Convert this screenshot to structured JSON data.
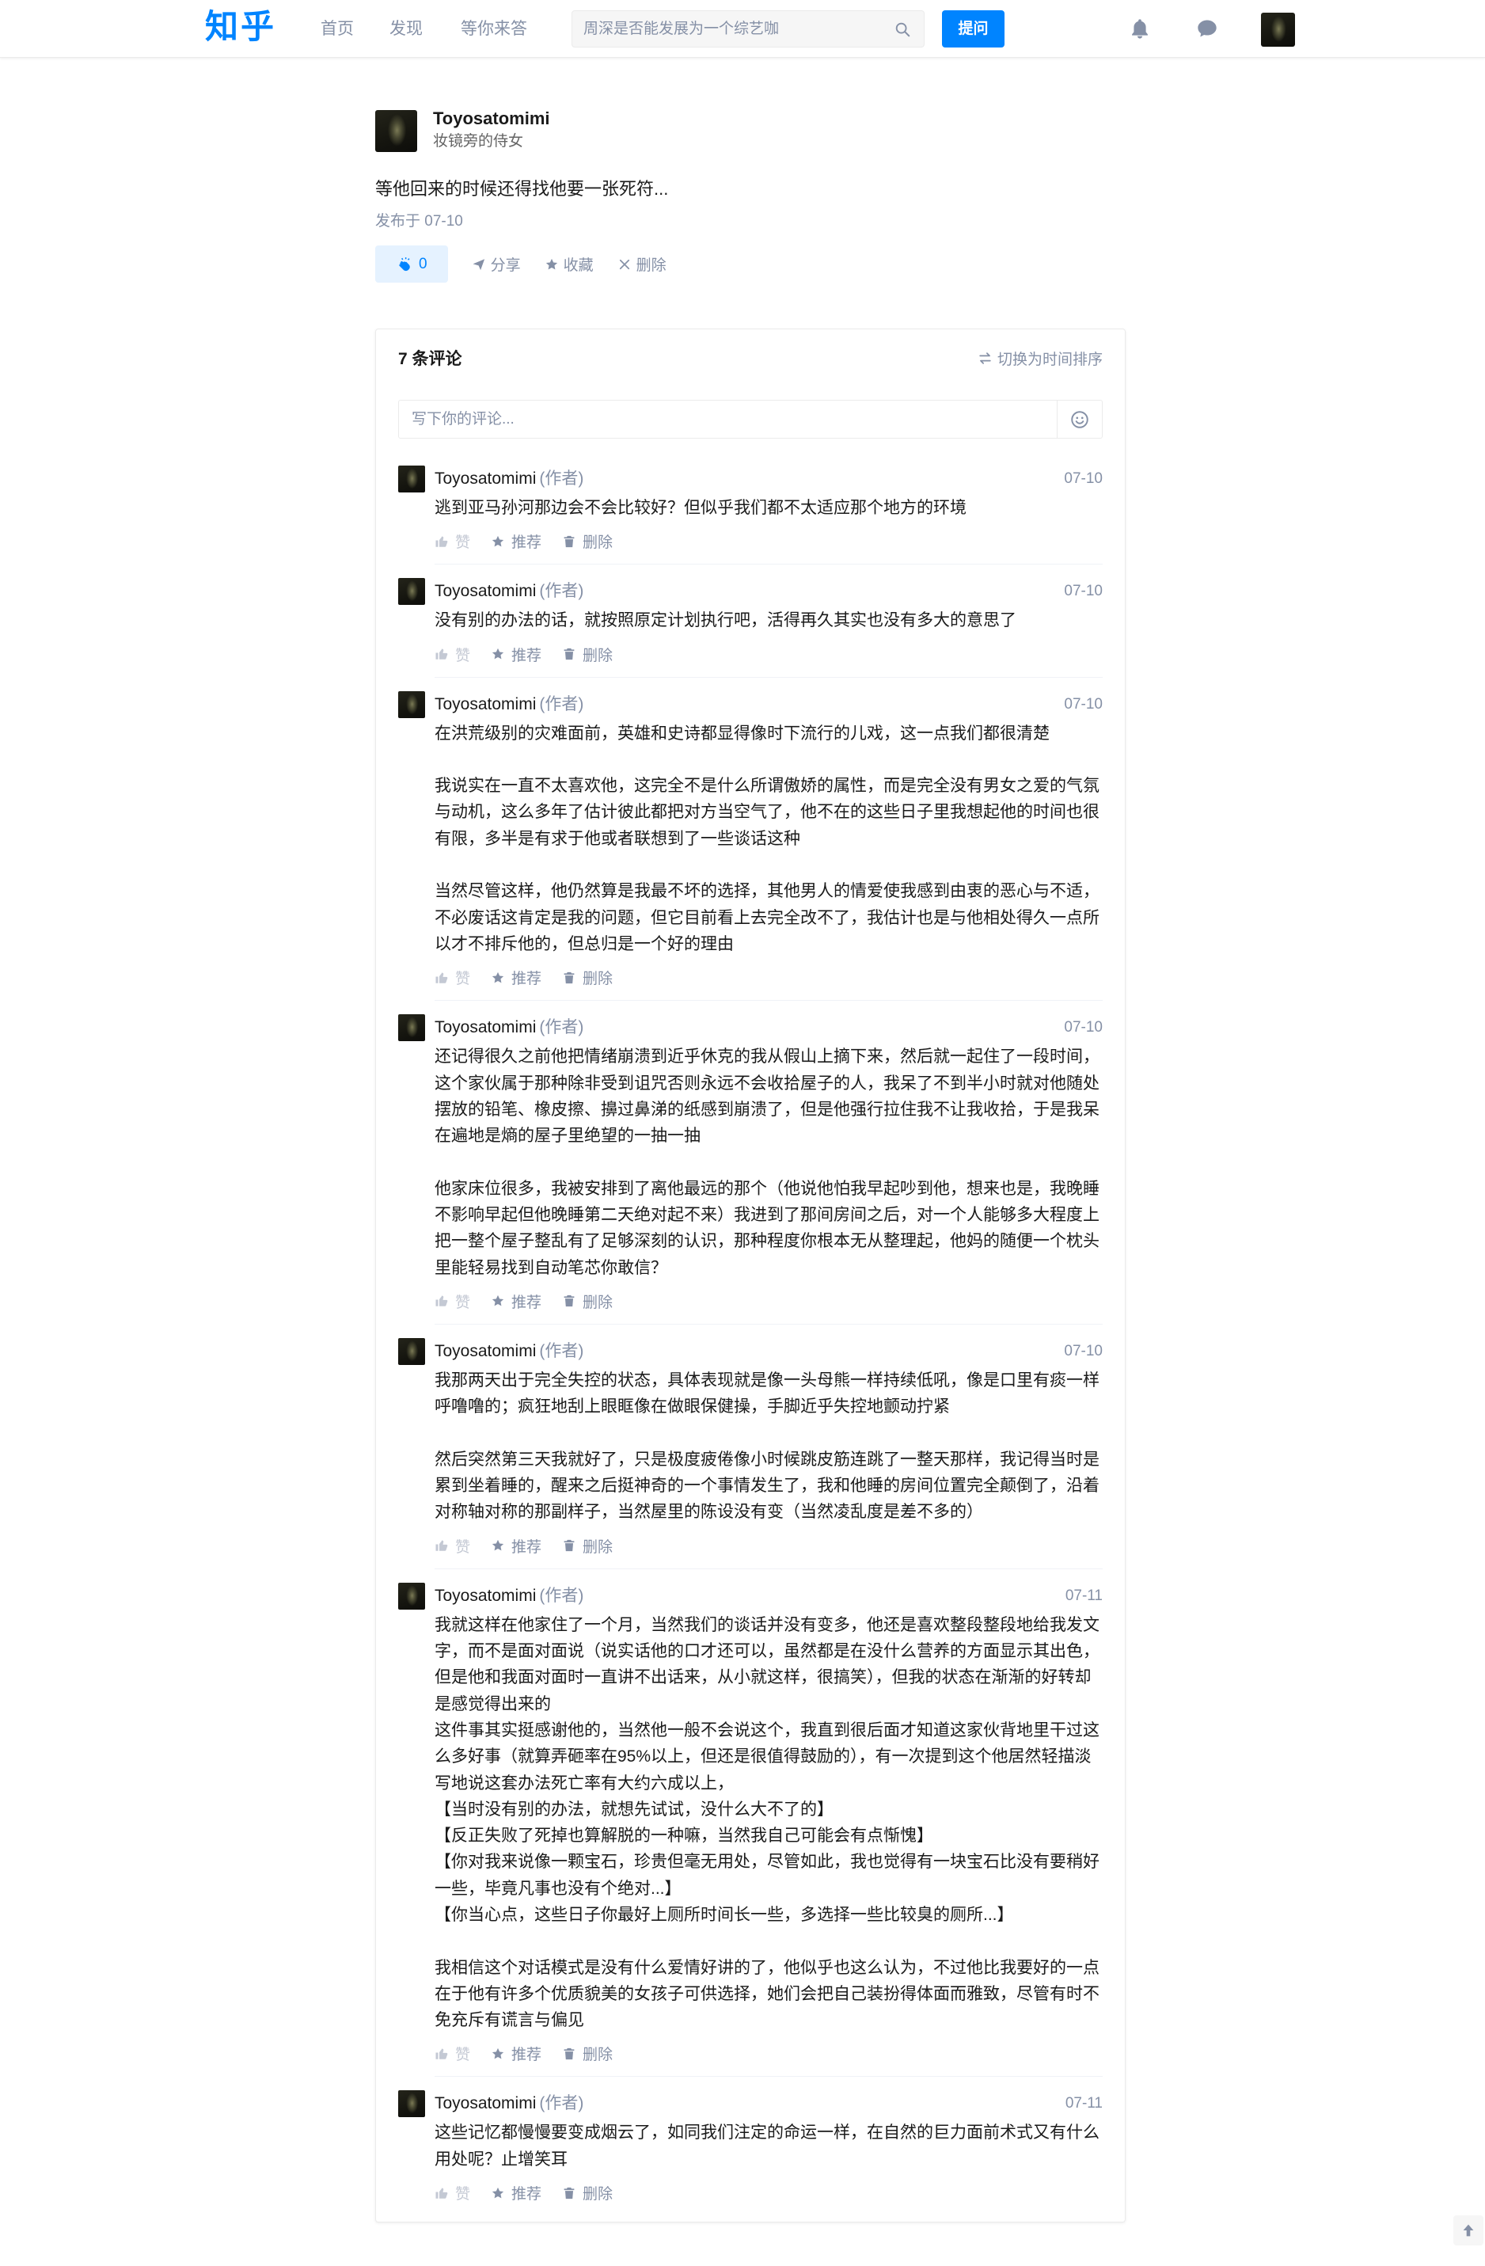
{
  "nav": {
    "logo": "知乎",
    "links": [
      "首页",
      "发现",
      "等你来答"
    ],
    "search_placeholder": "周深是否能发展为一个综艺咖",
    "ask_button": "提问",
    "icons": [
      "search-icon",
      "bell-icon",
      "chat-icon",
      "avatar"
    ]
  },
  "post": {
    "author_name": "Toyosatomimi",
    "author_headline": "妆镜旁的侍女",
    "content": "等他回来的时候还得找他要一张死符...",
    "published": "发布于 07-10",
    "like_count": "0",
    "share": "分享",
    "collect": "收藏",
    "delete": "删除"
  },
  "comments": {
    "title": "7 条评论",
    "sort_toggle": "切换为时间排序",
    "input_placeholder": "写下你的评论...",
    "author_tag": "(作者)",
    "action_labels": {
      "like": "赞",
      "recommend": "推荐",
      "delete": "删除"
    },
    "items": [
      {
        "author": "Toyosatomimi",
        "date": "07-10",
        "text": "逃到亚马孙河那边会不会比较好？但似乎我们都不太适应那个地方的环境"
      },
      {
        "author": "Toyosatomimi",
        "date": "07-10",
        "text": "没有别的办法的话，就按照原定计划执行吧，活得再久其实也没有多大的意思了"
      },
      {
        "author": "Toyosatomimi",
        "date": "07-10",
        "text": "在洪荒级别的灾难面前，英雄和史诗都显得像时下流行的儿戏，这一点我们都很清楚\n\n我说实在一直不太喜欢他，这完全不是什么所谓傲娇的属性，而是完全没有男女之爱的气氛与动机，这么多年了估计彼此都把对方当空气了，他不在的这些日子里我想起他的时间也很有限，多半是有求于他或者联想到了一些谈话这种\n\n当然尽管这样，他仍然算是我最不坏的选择，其他男人的情爱使我感到由衷的恶心与不适，不必废话这肯定是我的问题，但它目前看上去完全改不了，我估计也是与他相处得久一点所以才不排斥他的，但总归是一个好的理由"
      },
      {
        "author": "Toyosatomimi",
        "date": "07-10",
        "text": "还记得很久之前他把情绪崩溃到近乎休克的我从假山上摘下来，然后就一起住了一段时间，这个家伙属于那种除非受到诅咒否则永远不会收拾屋子的人，我呆了不到半小时就对他随处摆放的铅笔、橡皮擦、擤过鼻涕的纸感到崩溃了，但是他强行拉住我不让我收拾，于是我呆在遍地是熵的屋子里绝望的一抽一抽\n\n他家床位很多，我被安排到了离他最远的那个（他说他怕我早起吵到他，想来也是，我晚睡不影响早起但他晚睡第二天绝对起不来）我进到了那间房间之后，对一个人能够多大程度上把一整个屋子整乱有了足够深刻的认识，那种程度你根本无从整理起，他妈的随便一个枕头里能轻易找到自动笔芯你敢信？"
      },
      {
        "author": "Toyosatomimi",
        "date": "07-10",
        "text": "我那两天出于完全失控的状态，具体表现就是像一头母熊一样持续低吼，像是口里有痰一样呼噜噜的；疯狂地刮上眼眶像在做眼保健操，手脚近乎失控地颤动拧紧\n\n然后突然第三天我就好了，只是极度疲倦像小时候跳皮筋连跳了一整天那样，我记得当时是累到坐着睡的，醒来之后挺神奇的一个事情发生了，我和他睡的房间位置完全颠倒了，沿着对称轴对称的那副样子，当然屋里的陈设没有变（当然凌乱度是差不多的）"
      },
      {
        "author": "Toyosatomimi",
        "date": "07-11",
        "text": "我就这样在他家住了一个月，当然我们的谈话并没有变多，他还是喜欢整段整段地给我发文字，而不是面对面说（说实话他的口才还可以，虽然都是在没什么营养的方面显示其出色，但是他和我面对面时一直讲不出话来，从小就这样，很搞笑），但我的状态在渐渐的好转却是感觉得出来的\n这件事其实挺感谢他的，当然他一般不会说这个，我直到很后面才知道这家伙背地里干过这么多好事（就算弄砸率在95%以上，但还是很值得鼓励的），有一次提到这个他居然轻描淡写地说这套办法死亡率有大约六成以上，\n【当时没有别的办法，就想先试试，没什么大不了的】\n【反正失败了死掉也算解脱的一种嘛，当然我自己可能会有点惭愧】\n【你对我来说像一颗宝石，珍贵但毫无用处，尽管如此，我也觉得有一块宝石比没有要稍好一些，毕竟凡事也没有个绝对...】\n【你当心点，这些日子你最好上厕所时间长一些，多选择一些比较臭的厕所...】\n\n我相信这个对话模式是没有什么爱情好讲的了，他似乎也这么认为，不过他比我要好的一点在于他有许多个优质貌美的女孩子可供选择，她们会把自己装扮得体面而雅致，尽管有时不免充斥有谎言与偏见"
      },
      {
        "author": "Toyosatomimi",
        "date": "07-11",
        "text": "这些记忆都慢慢要变成烟云了，如同我们注定的命运一样，在自然的巨力面前术式又有什么用处呢？止增笑耳"
      }
    ]
  },
  "colors": {
    "brand": "#0084ff",
    "text": "#1a1a1a",
    "muted": "#8590a6",
    "like_bg": "#e5f2ff",
    "border": "#ebebeb"
  }
}
